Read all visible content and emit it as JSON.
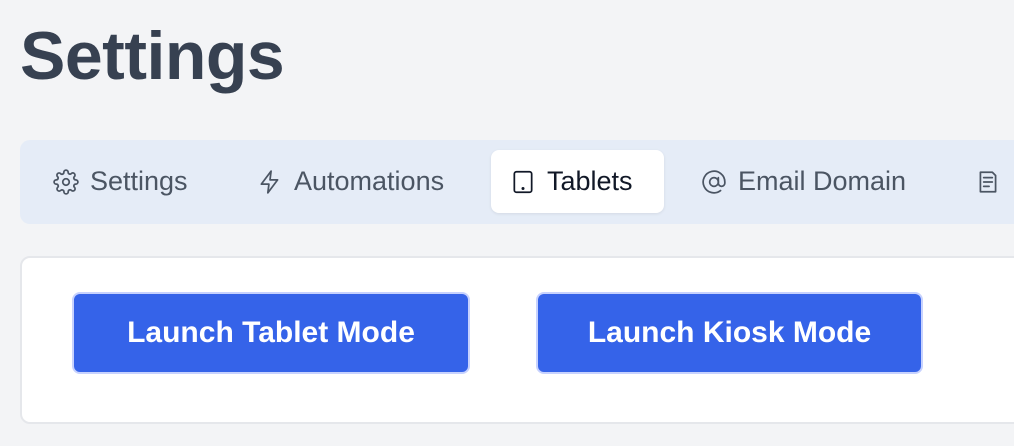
{
  "page": {
    "title": "Settings"
  },
  "tabs": [
    {
      "label": "Settings",
      "icon": "gear-icon",
      "active": false
    },
    {
      "label": "Automations",
      "icon": "lightning-icon",
      "active": false
    },
    {
      "label": "Tablets",
      "icon": "tablet-icon",
      "active": true
    },
    {
      "label": "Email Domain",
      "icon": "at-icon",
      "active": false
    },
    {
      "label": "",
      "icon": "document-icon",
      "active": false
    }
  ],
  "actions": {
    "launch_tablet_label": "Launch Tablet Mode",
    "launch_kiosk_label": "Launch Kiosk Mode"
  },
  "colors": {
    "accent": "#3563e9",
    "background": "#f3f4f6",
    "tab_bar": "#e5ecf7",
    "title": "#374151"
  }
}
